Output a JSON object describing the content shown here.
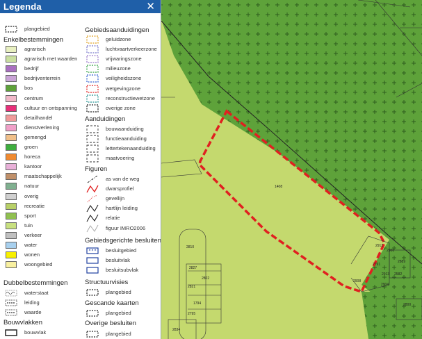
{
  "legend": {
    "title": "Legenda",
    "close_icon": "✕",
    "plangebied_top": "plangebied",
    "enkel": {
      "title": "Enkelbestemmingen",
      "items": [
        {
          "label": "agrarisch",
          "color": "#e8f0c0"
        },
        {
          "label": "agrarisch met waarden",
          "color": "#c9dfa0"
        },
        {
          "label": "bedrijf",
          "color": "#a96fc0"
        },
        {
          "label": "bedrijventerrein",
          "color": "#c9a3d6"
        },
        {
          "label": "bos",
          "color": "#5ea23a"
        },
        {
          "label": "centrum",
          "color": "#f0b8c8"
        },
        {
          "label": "cultuur en ontspanning",
          "color": "#e8307a"
        },
        {
          "label": "detailhandel",
          "color": "#f09a9a"
        },
        {
          "label": "dienstverlening",
          "color": "#f0a0c8"
        },
        {
          "label": "gemengd",
          "color": "#f0c08a"
        },
        {
          "label": "groen",
          "color": "#3fae3f"
        },
        {
          "label": "horeca",
          "color": "#f08a30"
        },
        {
          "label": "kantoor",
          "color": "#e8b0d8"
        },
        {
          "label": "maatschappelijk",
          "color": "#c0906a"
        },
        {
          "label": "natuur",
          "color": "#80b090"
        },
        {
          "label": "overig",
          "color": "#d0d0d0"
        },
        {
          "label": "recreatie",
          "color": "#b8d068"
        },
        {
          "label": "sport",
          "color": "#90c050"
        },
        {
          "label": "tuin",
          "color": "#c8e080"
        },
        {
          "label": "verkeer",
          "color": "#c0c0c0"
        },
        {
          "label": "water",
          "color": "#a8d0ee"
        },
        {
          "label": "wonen",
          "color": "#f8f000"
        },
        {
          "label": "woongebied",
          "color": "#f8f0a0"
        }
      ]
    },
    "dubbel": {
      "title": "Dubbelbestemmingen",
      "items": [
        {
          "label": "waterstaat",
          "icon": "waves-icon"
        },
        {
          "label": "leiding",
          "icon": "dots-icon"
        },
        {
          "label": "waarde",
          "icon": "dots-icon"
        }
      ]
    },
    "bouwvlakken": {
      "title": "Bouwvlakken",
      "items": [
        {
          "label": "bouwvlak",
          "icon": "bouwvlak-icon"
        }
      ]
    },
    "gebied": {
      "title": "Gebiedsaanduidingen",
      "items": [
        {
          "label": "geluidzone",
          "color": "#e0a020"
        },
        {
          "label": "luchtvaartverkeerzone",
          "color": "#7a7acc"
        },
        {
          "label": "vrijwaringszone",
          "color": "#9a7acc"
        },
        {
          "label": "milieuzone",
          "color": "#30a040"
        },
        {
          "label": "veiligheidszone",
          "color": "#3060d0"
        },
        {
          "label": "wetgevingzone",
          "color": "#e02020"
        },
        {
          "label": "reconstructiewetzone",
          "color": "#209090"
        },
        {
          "label": "overige zone",
          "color": "#222222"
        }
      ]
    },
    "aand": {
      "title": "Aanduidingen",
      "items": [
        {
          "label": "bouwaanduiding"
        },
        {
          "label": "functieaanduiding"
        },
        {
          "label": "lettertekenaanduiding"
        },
        {
          "label": "maatvoering"
        }
      ]
    },
    "figuren": {
      "title": "Figuren",
      "items": [
        {
          "label": "as van de weg",
          "icon": "dashdot-line-icon"
        },
        {
          "label": "dwarsprofiel",
          "icon": "zigzag-red-icon"
        },
        {
          "label": "gevellijn",
          "icon": "dotted-red-line-icon"
        },
        {
          "label": "hartlijn leiding",
          "icon": "zigzag-black-icon"
        },
        {
          "label": "relatie",
          "icon": "zigzag-black-icon"
        },
        {
          "label": "figuur IMRO2006",
          "icon": "grey-line-icon"
        }
      ]
    },
    "gebiedsgericht": {
      "title": "Gebiedsgerichte besluiten",
      "items": [
        {
          "label": "besluitgebied",
          "icon": "cross-hatch-icon"
        },
        {
          "label": "besluitvlak",
          "icon": "blue-rect-icon"
        },
        {
          "label": "besluitsubvlak",
          "icon": "blue-rect-icon"
        }
      ]
    },
    "structuur": {
      "title": "Structuurvisies",
      "items": [
        {
          "label": "plangebied"
        }
      ]
    },
    "gescand": {
      "title": "Gescande kaarten",
      "items": [
        {
          "label": "plangebied"
        }
      ]
    },
    "overige": {
      "title": "Overige besluiten",
      "items": [
        {
          "label": "plangebied"
        }
      ]
    }
  },
  "map": {
    "parcels": [
      "1408",
      "2810",
      "2827",
      "2802",
      "2821",
      "1794",
      "2795",
      "2834",
      "2912",
      "2906",
      "2889",
      "2791",
      "2913",
      "2908",
      "2904",
      "2582",
      "2800"
    ],
    "colors": {
      "agrarisch": "#c4d96e",
      "bos": "#5ea23a",
      "outline": "#e02020"
    }
  }
}
